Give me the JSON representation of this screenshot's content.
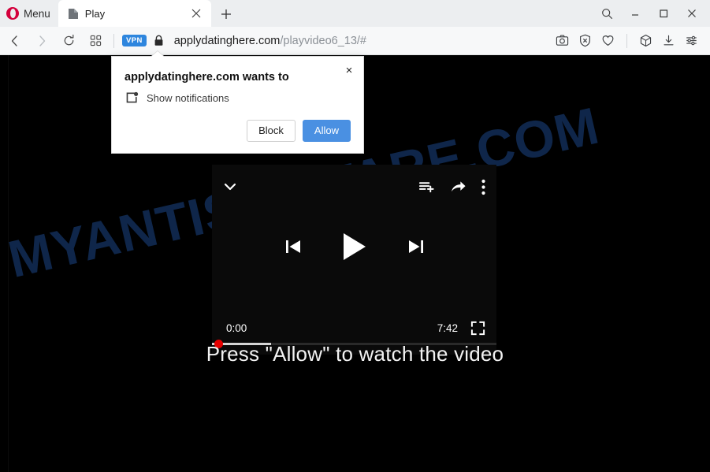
{
  "browser": {
    "menu_label": "Menu",
    "tab": {
      "title": "Play",
      "favicon": "page-icon",
      "close": "×"
    },
    "new_tab": "+",
    "window_controls": {
      "search": "search-icon",
      "minimize": "minimize-icon",
      "maximize": "maximize-icon",
      "close": "close-icon"
    },
    "toolbar": {
      "back": "back-arrow-icon",
      "forward": "forward-arrow-icon",
      "reload": "reload-icon",
      "tab_overview": "grid-icon",
      "vpn_badge": "VPN",
      "lock": "padlock-icon",
      "url_domain": "applydatinghere.com",
      "url_path": "/playvideo6_13/#",
      "right_icons": [
        {
          "name": "snapshot-icon",
          "label": "Snapshot"
        },
        {
          "name": "ad-blocker-icon",
          "label": "Ad blocker"
        },
        {
          "name": "heart-icon",
          "label": "Add to favorites"
        },
        {
          "name": "workspaces-icon",
          "label": "Workspaces"
        },
        {
          "name": "downloads-icon",
          "label": "Downloads"
        },
        {
          "name": "easy-setup-icon",
          "label": "Easy setup"
        }
      ]
    }
  },
  "permission_popup": {
    "title": "applydatinghere.com wants to",
    "permission_icon": "notifications-icon",
    "permission_label": "Show notifications",
    "close_label": "×",
    "block_label": "Block",
    "allow_label": "Allow",
    "allow_color": "#4a90e2"
  },
  "page": {
    "watermark": "MYANTISPYWARE.COM",
    "watermark_color": "#10294f",
    "background_color": "#000000",
    "cta_text": "Press \"Allow\" to watch the video"
  },
  "player": {
    "collapse_icon": "chevron-down-icon",
    "queue_icon": "add-to-queue-icon",
    "share_icon": "share-icon",
    "more_icon": "more-vertical-icon",
    "previous_icon": "previous-track-icon",
    "play_icon": "play-icon",
    "next_icon": "next-track-icon",
    "current_time": "0:00",
    "duration": "7:42",
    "fullscreen_icon": "fullscreen-icon",
    "progress_percent": 0,
    "buffered_percent": 21,
    "scrubber_color": "#e60000"
  }
}
